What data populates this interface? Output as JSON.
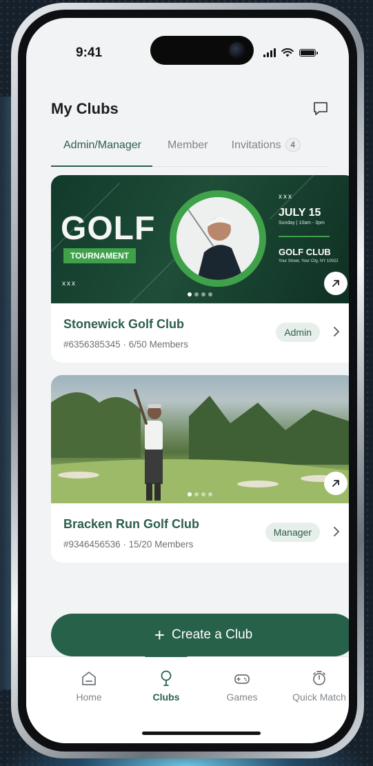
{
  "status_bar": {
    "time": "9:41"
  },
  "header": {
    "title": "My Clubs"
  },
  "tabs": [
    {
      "label": "Admin/Manager",
      "active": true
    },
    {
      "label": "Member",
      "active": false
    },
    {
      "label": "Invitations",
      "active": false,
      "badge": "4"
    }
  ],
  "clubs": [
    {
      "name": "Stonewick Golf Club",
      "meta": "#6356385345 · 6/50 Members",
      "role": "Admin",
      "image_slides": 4,
      "active_slide": 1,
      "poster": {
        "title": "GOLF",
        "subtitle": "TOURNAMENT",
        "marks": "xxx",
        "date": "JULY 15",
        "time": "Sunday | 10am - 3pm",
        "club": "GOLF CLUB",
        "address": "Your Street, Your City, NY 10022"
      }
    },
    {
      "name": "Bracken Run Golf Club",
      "meta": "#9346456536 · 15/20 Members",
      "role": "Manager",
      "image_slides": 4,
      "active_slide": 1
    }
  ],
  "create_button": {
    "label": "Create a Club"
  },
  "bottom_nav": [
    {
      "label": "Home",
      "icon": "home-icon",
      "active": false
    },
    {
      "label": "Clubs",
      "icon": "golf-pin-icon",
      "active": true
    },
    {
      "label": "Games",
      "icon": "gamepad-icon",
      "active": false
    },
    {
      "label": "Quick Match",
      "icon": "stopwatch-icon",
      "active": false
    }
  ],
  "colors": {
    "primary": "#27614a",
    "accent_text": "#2d5e4c",
    "background": "#f2f3f4",
    "role_badge_bg": "#e7efea"
  }
}
